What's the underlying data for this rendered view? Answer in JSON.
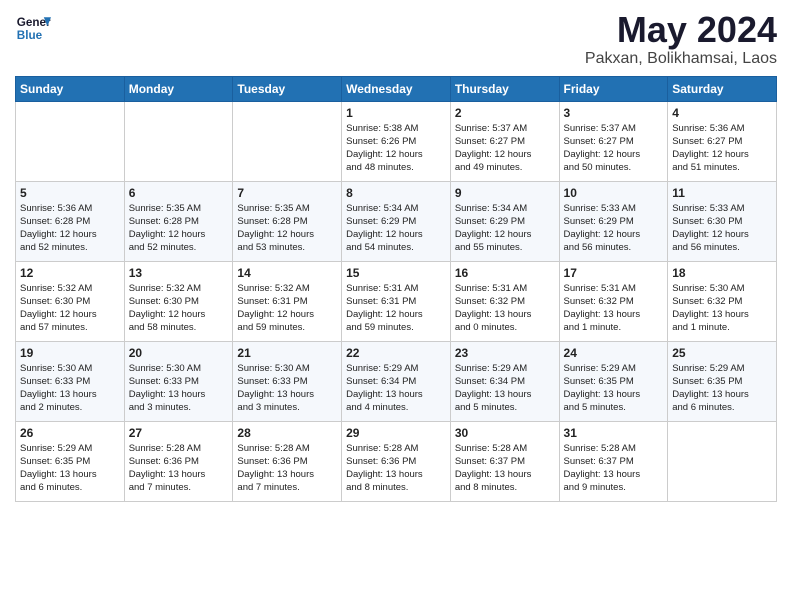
{
  "header": {
    "logo_line1": "General",
    "logo_line2": "Blue",
    "month_year": "May 2024",
    "location": "Pakxan, Bolikhamsai, Laos"
  },
  "days_of_week": [
    "Sunday",
    "Monday",
    "Tuesday",
    "Wednesday",
    "Thursday",
    "Friday",
    "Saturday"
  ],
  "weeks": [
    [
      {
        "day": "",
        "info": ""
      },
      {
        "day": "",
        "info": ""
      },
      {
        "day": "",
        "info": ""
      },
      {
        "day": "1",
        "info": "Sunrise: 5:38 AM\nSunset: 6:26 PM\nDaylight: 12 hours\nand 48 minutes."
      },
      {
        "day": "2",
        "info": "Sunrise: 5:37 AM\nSunset: 6:27 PM\nDaylight: 12 hours\nand 49 minutes."
      },
      {
        "day": "3",
        "info": "Sunrise: 5:37 AM\nSunset: 6:27 PM\nDaylight: 12 hours\nand 50 minutes."
      },
      {
        "day": "4",
        "info": "Sunrise: 5:36 AM\nSunset: 6:27 PM\nDaylight: 12 hours\nand 51 minutes."
      }
    ],
    [
      {
        "day": "5",
        "info": "Sunrise: 5:36 AM\nSunset: 6:28 PM\nDaylight: 12 hours\nand 52 minutes."
      },
      {
        "day": "6",
        "info": "Sunrise: 5:35 AM\nSunset: 6:28 PM\nDaylight: 12 hours\nand 52 minutes."
      },
      {
        "day": "7",
        "info": "Sunrise: 5:35 AM\nSunset: 6:28 PM\nDaylight: 12 hours\nand 53 minutes."
      },
      {
        "day": "8",
        "info": "Sunrise: 5:34 AM\nSunset: 6:29 PM\nDaylight: 12 hours\nand 54 minutes."
      },
      {
        "day": "9",
        "info": "Sunrise: 5:34 AM\nSunset: 6:29 PM\nDaylight: 12 hours\nand 55 minutes."
      },
      {
        "day": "10",
        "info": "Sunrise: 5:33 AM\nSunset: 6:29 PM\nDaylight: 12 hours\nand 56 minutes."
      },
      {
        "day": "11",
        "info": "Sunrise: 5:33 AM\nSunset: 6:30 PM\nDaylight: 12 hours\nand 56 minutes."
      }
    ],
    [
      {
        "day": "12",
        "info": "Sunrise: 5:32 AM\nSunset: 6:30 PM\nDaylight: 12 hours\nand 57 minutes."
      },
      {
        "day": "13",
        "info": "Sunrise: 5:32 AM\nSunset: 6:30 PM\nDaylight: 12 hours\nand 58 minutes."
      },
      {
        "day": "14",
        "info": "Sunrise: 5:32 AM\nSunset: 6:31 PM\nDaylight: 12 hours\nand 59 minutes."
      },
      {
        "day": "15",
        "info": "Sunrise: 5:31 AM\nSunset: 6:31 PM\nDaylight: 12 hours\nand 59 minutes."
      },
      {
        "day": "16",
        "info": "Sunrise: 5:31 AM\nSunset: 6:32 PM\nDaylight: 13 hours\nand 0 minutes."
      },
      {
        "day": "17",
        "info": "Sunrise: 5:31 AM\nSunset: 6:32 PM\nDaylight: 13 hours\nand 1 minute."
      },
      {
        "day": "18",
        "info": "Sunrise: 5:30 AM\nSunset: 6:32 PM\nDaylight: 13 hours\nand 1 minute."
      }
    ],
    [
      {
        "day": "19",
        "info": "Sunrise: 5:30 AM\nSunset: 6:33 PM\nDaylight: 13 hours\nand 2 minutes."
      },
      {
        "day": "20",
        "info": "Sunrise: 5:30 AM\nSunset: 6:33 PM\nDaylight: 13 hours\nand 3 minutes."
      },
      {
        "day": "21",
        "info": "Sunrise: 5:30 AM\nSunset: 6:33 PM\nDaylight: 13 hours\nand 3 minutes."
      },
      {
        "day": "22",
        "info": "Sunrise: 5:29 AM\nSunset: 6:34 PM\nDaylight: 13 hours\nand 4 minutes."
      },
      {
        "day": "23",
        "info": "Sunrise: 5:29 AM\nSunset: 6:34 PM\nDaylight: 13 hours\nand 5 minutes."
      },
      {
        "day": "24",
        "info": "Sunrise: 5:29 AM\nSunset: 6:35 PM\nDaylight: 13 hours\nand 5 minutes."
      },
      {
        "day": "25",
        "info": "Sunrise: 5:29 AM\nSunset: 6:35 PM\nDaylight: 13 hours\nand 6 minutes."
      }
    ],
    [
      {
        "day": "26",
        "info": "Sunrise: 5:29 AM\nSunset: 6:35 PM\nDaylight: 13 hours\nand 6 minutes."
      },
      {
        "day": "27",
        "info": "Sunrise: 5:28 AM\nSunset: 6:36 PM\nDaylight: 13 hours\nand 7 minutes."
      },
      {
        "day": "28",
        "info": "Sunrise: 5:28 AM\nSunset: 6:36 PM\nDaylight: 13 hours\nand 7 minutes."
      },
      {
        "day": "29",
        "info": "Sunrise: 5:28 AM\nSunset: 6:36 PM\nDaylight: 13 hours\nand 8 minutes."
      },
      {
        "day": "30",
        "info": "Sunrise: 5:28 AM\nSunset: 6:37 PM\nDaylight: 13 hours\nand 8 minutes."
      },
      {
        "day": "31",
        "info": "Sunrise: 5:28 AM\nSunset: 6:37 PM\nDaylight: 13 hours\nand 9 minutes."
      },
      {
        "day": "",
        "info": ""
      }
    ]
  ]
}
